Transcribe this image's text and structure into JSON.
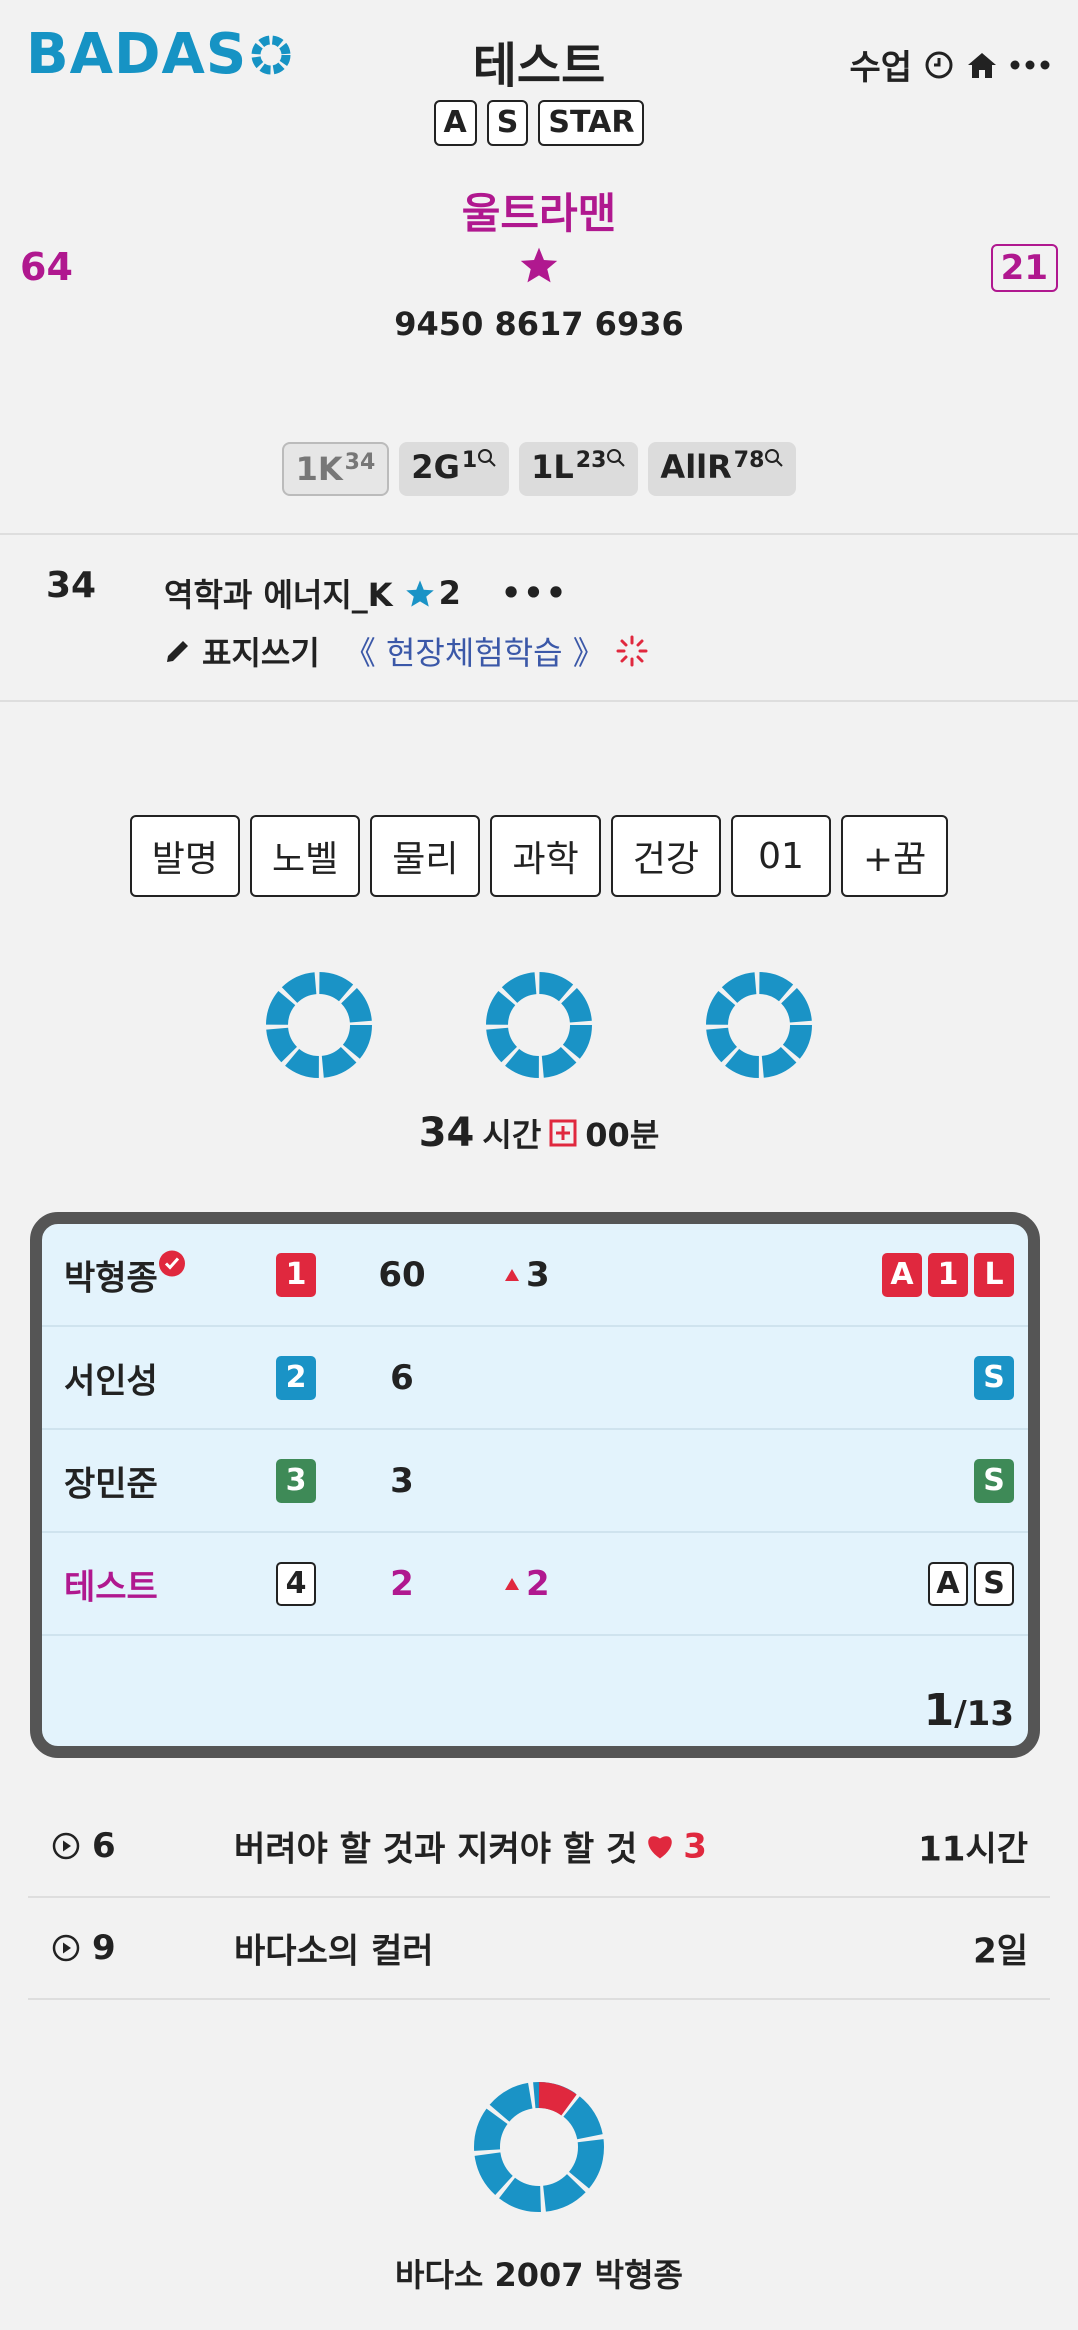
{
  "header": {
    "logo": "BADAS",
    "title": "테스트",
    "class_label": "수업",
    "chips": [
      "A",
      "S",
      "STAR"
    ]
  },
  "profile": {
    "username": "울트라맨",
    "left_count": "64",
    "right_badge": "21",
    "phone": "9450 8617 6936"
  },
  "tags": [
    {
      "main": "1K",
      "sup": "34",
      "search": false
    },
    {
      "main": "2G",
      "sup": "1",
      "search": true
    },
    {
      "main": "1L",
      "sup": "23",
      "search": true
    },
    {
      "main": "AllR",
      "sup": "78",
      "search": true
    }
  ],
  "course": {
    "number": "34",
    "title": "역학과 에너지_K",
    "stars": "2",
    "more": "•••",
    "write_label": "표지쓰기",
    "link": "《 현장체험학습 》"
  },
  "categories": [
    "발명",
    "노벨",
    "물리",
    "과학",
    "건강",
    "01",
    "+꿈"
  ],
  "study_time": {
    "hours": "34",
    "hours_unit": "시간",
    "minutes": "00분"
  },
  "ranking": {
    "rows": [
      {
        "name": "박형종",
        "rank": "1",
        "score": "60",
        "delta": "3",
        "badges": [
          "A",
          "1",
          "L"
        ]
      },
      {
        "name": "서인성",
        "rank": "2",
        "score": "6",
        "delta": "",
        "badges": [
          "S"
        ]
      },
      {
        "name": "장민준",
        "rank": "3",
        "score": "3",
        "delta": "",
        "badges": [
          "S"
        ]
      },
      {
        "name": "테스트",
        "rank": "4",
        "score": "2",
        "delta": "2",
        "badges": [
          "A",
          "S"
        ]
      }
    ],
    "page_current": "1",
    "page_total": "/13"
  },
  "lessons": [
    {
      "count": "6",
      "title": "버려야 할 것과 지켜야 할 것",
      "likes": "3",
      "time": "11시간"
    },
    {
      "count": "9",
      "title": "바다소의 컬러",
      "likes": "",
      "time": "2일"
    }
  ],
  "footer": "바다소 2007 박형종",
  "colors": {
    "brand": "#1693c4",
    "magenta": "#b0188f",
    "red": "#e0283e",
    "blue": "#1a93c6",
    "green": "#3e8a57",
    "link": "#3b58a8"
  }
}
